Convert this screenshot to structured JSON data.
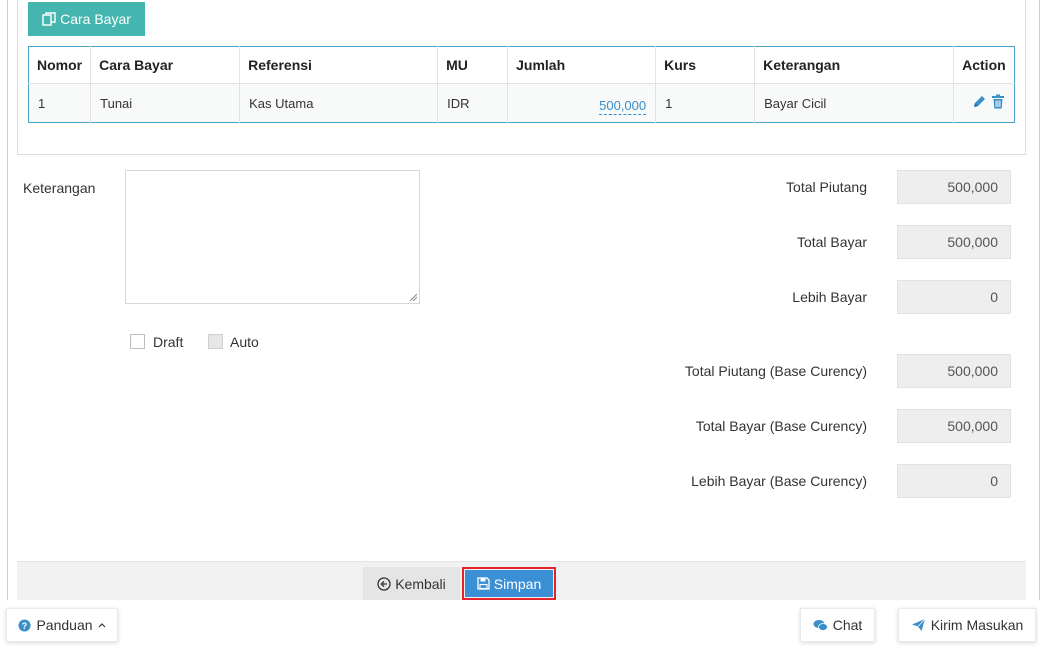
{
  "payment_method_button": {
    "label": "Cara Bayar",
    "icon": "copy-icon"
  },
  "table": {
    "headers": [
      "Nomor",
      "Cara Bayar",
      "Referensi",
      "MU",
      "Jumlah",
      "Kurs",
      "Keterangan",
      "Action"
    ],
    "rows": [
      {
        "nomor": "1",
        "cara_bayar": "Tunai",
        "referensi": "Kas Utama",
        "mu": "IDR",
        "jumlah": "500,000",
        "kurs": "1",
        "keterangan": "Bayar Cicil"
      }
    ]
  },
  "form": {
    "keterangan_label": "Keterangan",
    "keterangan_value": "",
    "draft_label": "Draft",
    "auto_label": "Auto"
  },
  "totals": [
    {
      "label": "Total Piutang",
      "value": "500,000"
    },
    {
      "label": "Total Bayar",
      "value": "500,000"
    },
    {
      "label": "Lebih Bayar",
      "value": "0"
    },
    {
      "label": "Total Piutang (Base Curency)",
      "value": "500,000"
    },
    {
      "label": "Total Bayar (Base Curency)",
      "value": "500,000"
    },
    {
      "label": "Lebih Bayar (Base Curency)",
      "value": "0"
    }
  ],
  "actions": {
    "back_label": "Kembali",
    "save_label": "Simpan"
  },
  "floating": {
    "guide_label": "Panduan",
    "chat_label": "Chat",
    "feedback_label": "Kirim Masukan"
  },
  "colors": {
    "teal": "#45b6af",
    "primary": "#3b8fd4",
    "highlight": "#e3222c",
    "link": "#3a8fc9"
  }
}
